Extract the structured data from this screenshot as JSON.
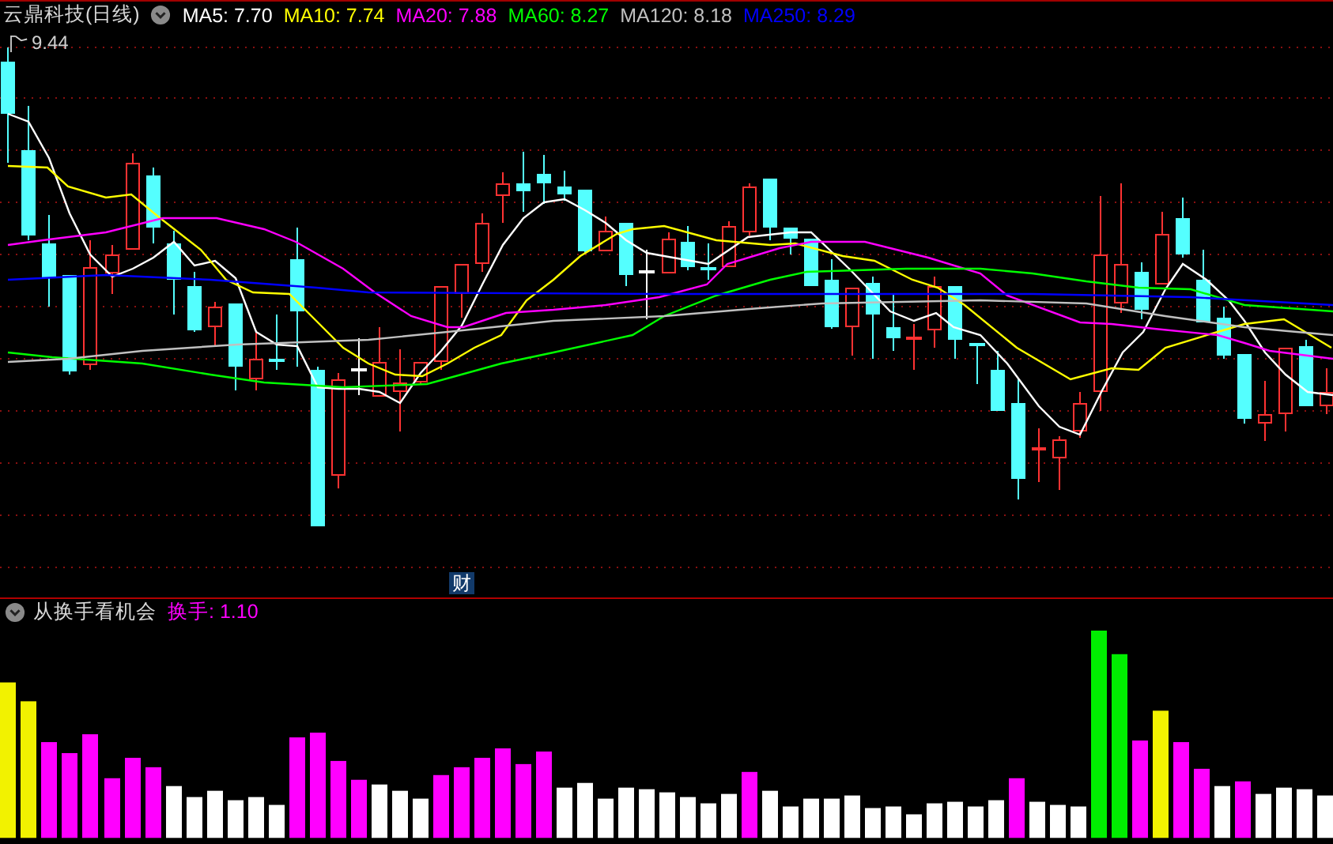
{
  "chart_header": {
    "title": "云鼎科技(日线)",
    "moving_averages": [
      {
        "label": "MA5: 7.70",
        "color": "#ffffff"
      },
      {
        "label": "MA10: 7.74",
        "color": "#ffff00"
      },
      {
        "label": "MA20: 7.88",
        "color": "#ff00ff"
      },
      {
        "label": "MA60: 8.27",
        "color": "#00ff00"
      },
      {
        "label": "MA120: 8.18",
        "color": "#c0c0c0"
      },
      {
        "label": "MA250: 8.29",
        "color": "#0000ff"
      }
    ]
  },
  "price_chart": {
    "high_label": "9.44",
    "event_marker": "财"
  },
  "indicator_header": {
    "title": "从换手看机会",
    "reading": "换手: 1.10"
  }
}
